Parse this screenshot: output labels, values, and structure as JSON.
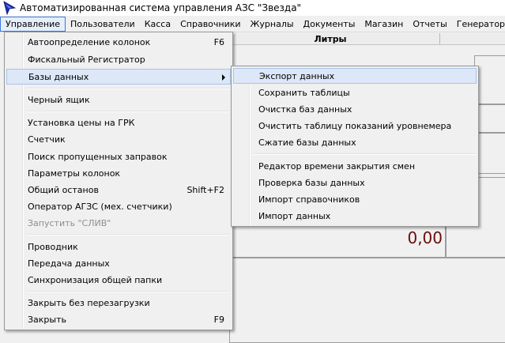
{
  "window": {
    "title": "Автоматизированная система управления АЗС \"Звезда\"",
    "icon": "arrow-cursor-icon"
  },
  "menubar": {
    "items": [
      {
        "label": "Управление"
      },
      {
        "label": "Пользователи"
      },
      {
        "label": "Касса"
      },
      {
        "label": "Справочники"
      },
      {
        "label": "Журналы"
      },
      {
        "label": "Документы"
      },
      {
        "label": "Магазин"
      },
      {
        "label": "Отчеты"
      },
      {
        "label": "Генератор отче"
      }
    ]
  },
  "background": {
    "column_header": "Литры",
    "liters_value": "0,00"
  },
  "dropdown": {
    "items": [
      {
        "label": "Автоопределение колонок",
        "shortcut": "F6"
      },
      {
        "label": "Фискальный Регистратор"
      },
      {
        "label": "Базы данных"
      },
      {
        "label": "Черный ящик"
      },
      {
        "label": "Установка цены на ГРК"
      },
      {
        "label": "Счетчик"
      },
      {
        "label": "Поиск пропущенных заправок"
      },
      {
        "label": "Параметры колонок"
      },
      {
        "label": "Общий останов",
        "shortcut": "Shift+F2"
      },
      {
        "label": "Оператор АГЗС (мех. счетчики)"
      },
      {
        "label": "Запустить \"СЛИВ\""
      },
      {
        "label": "Проводник"
      },
      {
        "label": "Передача данных"
      },
      {
        "label": "Синхронизация общей папки"
      },
      {
        "label": "Закрыть без перезагрузки"
      },
      {
        "label": "Закрыть",
        "shortcut": "F9"
      }
    ]
  },
  "submenu": {
    "items": [
      {
        "label": "Экспорт данных"
      },
      {
        "label": "Сохранить таблицы"
      },
      {
        "label": "Очистка баз данных"
      },
      {
        "label": "Очистить таблицу показаний уровнемера"
      },
      {
        "label": "Сжатие базы данных"
      },
      {
        "label": "Редактор времени закрытия смен"
      },
      {
        "label": "Проверка базы данных"
      },
      {
        "label": "Импорт справочников"
      },
      {
        "label": "Импорт данных"
      }
    ]
  },
  "colors": {
    "menu_highlight": "#dce7f7",
    "active_menu_border": "#3d7bd5",
    "value_color": "#6b0c0c"
  }
}
